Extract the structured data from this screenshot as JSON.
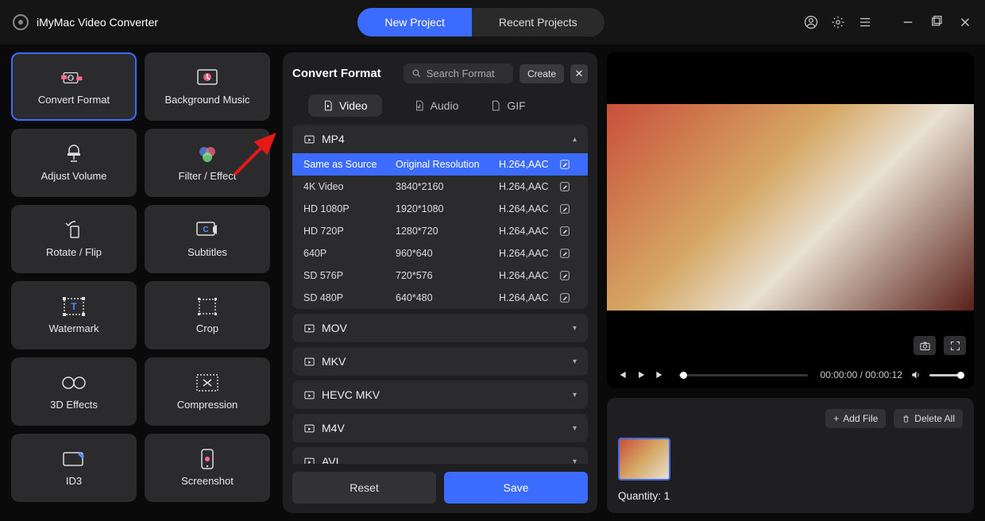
{
  "app_title": "iMyMac Video Converter",
  "header": {
    "new_project": "New Project",
    "recent_projects": "Recent Projects"
  },
  "tools": [
    {
      "name": "Convert Format",
      "icon": "convert-icon",
      "active": true
    },
    {
      "name": "Background Music",
      "icon": "music-icon"
    },
    {
      "name": "Adjust Volume",
      "icon": "volume-icon"
    },
    {
      "name": "Filter / Effect",
      "icon": "filter-icon"
    },
    {
      "name": "Rotate / Flip",
      "icon": "rotate-icon"
    },
    {
      "name": "Subtitles",
      "icon": "subtitles-icon"
    },
    {
      "name": "Watermark",
      "icon": "watermark-icon"
    },
    {
      "name": "Crop",
      "icon": "crop-icon"
    },
    {
      "name": "3D Effects",
      "icon": "3d-icon"
    },
    {
      "name": "Compression",
      "icon": "compress-icon"
    },
    {
      "name": "ID3",
      "icon": "id3-icon"
    },
    {
      "name": "Screenshot",
      "icon": "screenshot-icon"
    }
  ],
  "format_panel": {
    "heading": "Convert Format",
    "search_placeholder": "Search Format",
    "create_label": "Create",
    "tabs": {
      "video": "Video",
      "audio": "Audio",
      "gif": "GIF"
    },
    "open_group": "MP4",
    "mp4_rows": [
      {
        "label": "Same as Source",
        "res": "Original Resolution",
        "codec": "H.264,AAC",
        "selected": true
      },
      {
        "label": "4K Video",
        "res": "3840*2160",
        "codec": "H.264,AAC"
      },
      {
        "label": "HD 1080P",
        "res": "1920*1080",
        "codec": "H.264,AAC"
      },
      {
        "label": "HD 720P",
        "res": "1280*720",
        "codec": "H.264,AAC"
      },
      {
        "label": "640P",
        "res": "960*640",
        "codec": "H.264,AAC"
      },
      {
        "label": "SD 576P",
        "res": "720*576",
        "codec": "H.264,AAC"
      },
      {
        "label": "SD 480P",
        "res": "640*480",
        "codec": "H.264,AAC"
      }
    ],
    "collapsed_groups": [
      "MOV",
      "MKV",
      "HEVC MKV",
      "M4V",
      "AVI"
    ],
    "reset": "Reset",
    "save": "Save"
  },
  "player": {
    "current_time": "00:00:00",
    "duration": "00:00:12"
  },
  "file_box": {
    "add_file": "Add File",
    "delete_all": "Delete All",
    "quantity_label": "Quantity:",
    "quantity_value": "1"
  }
}
